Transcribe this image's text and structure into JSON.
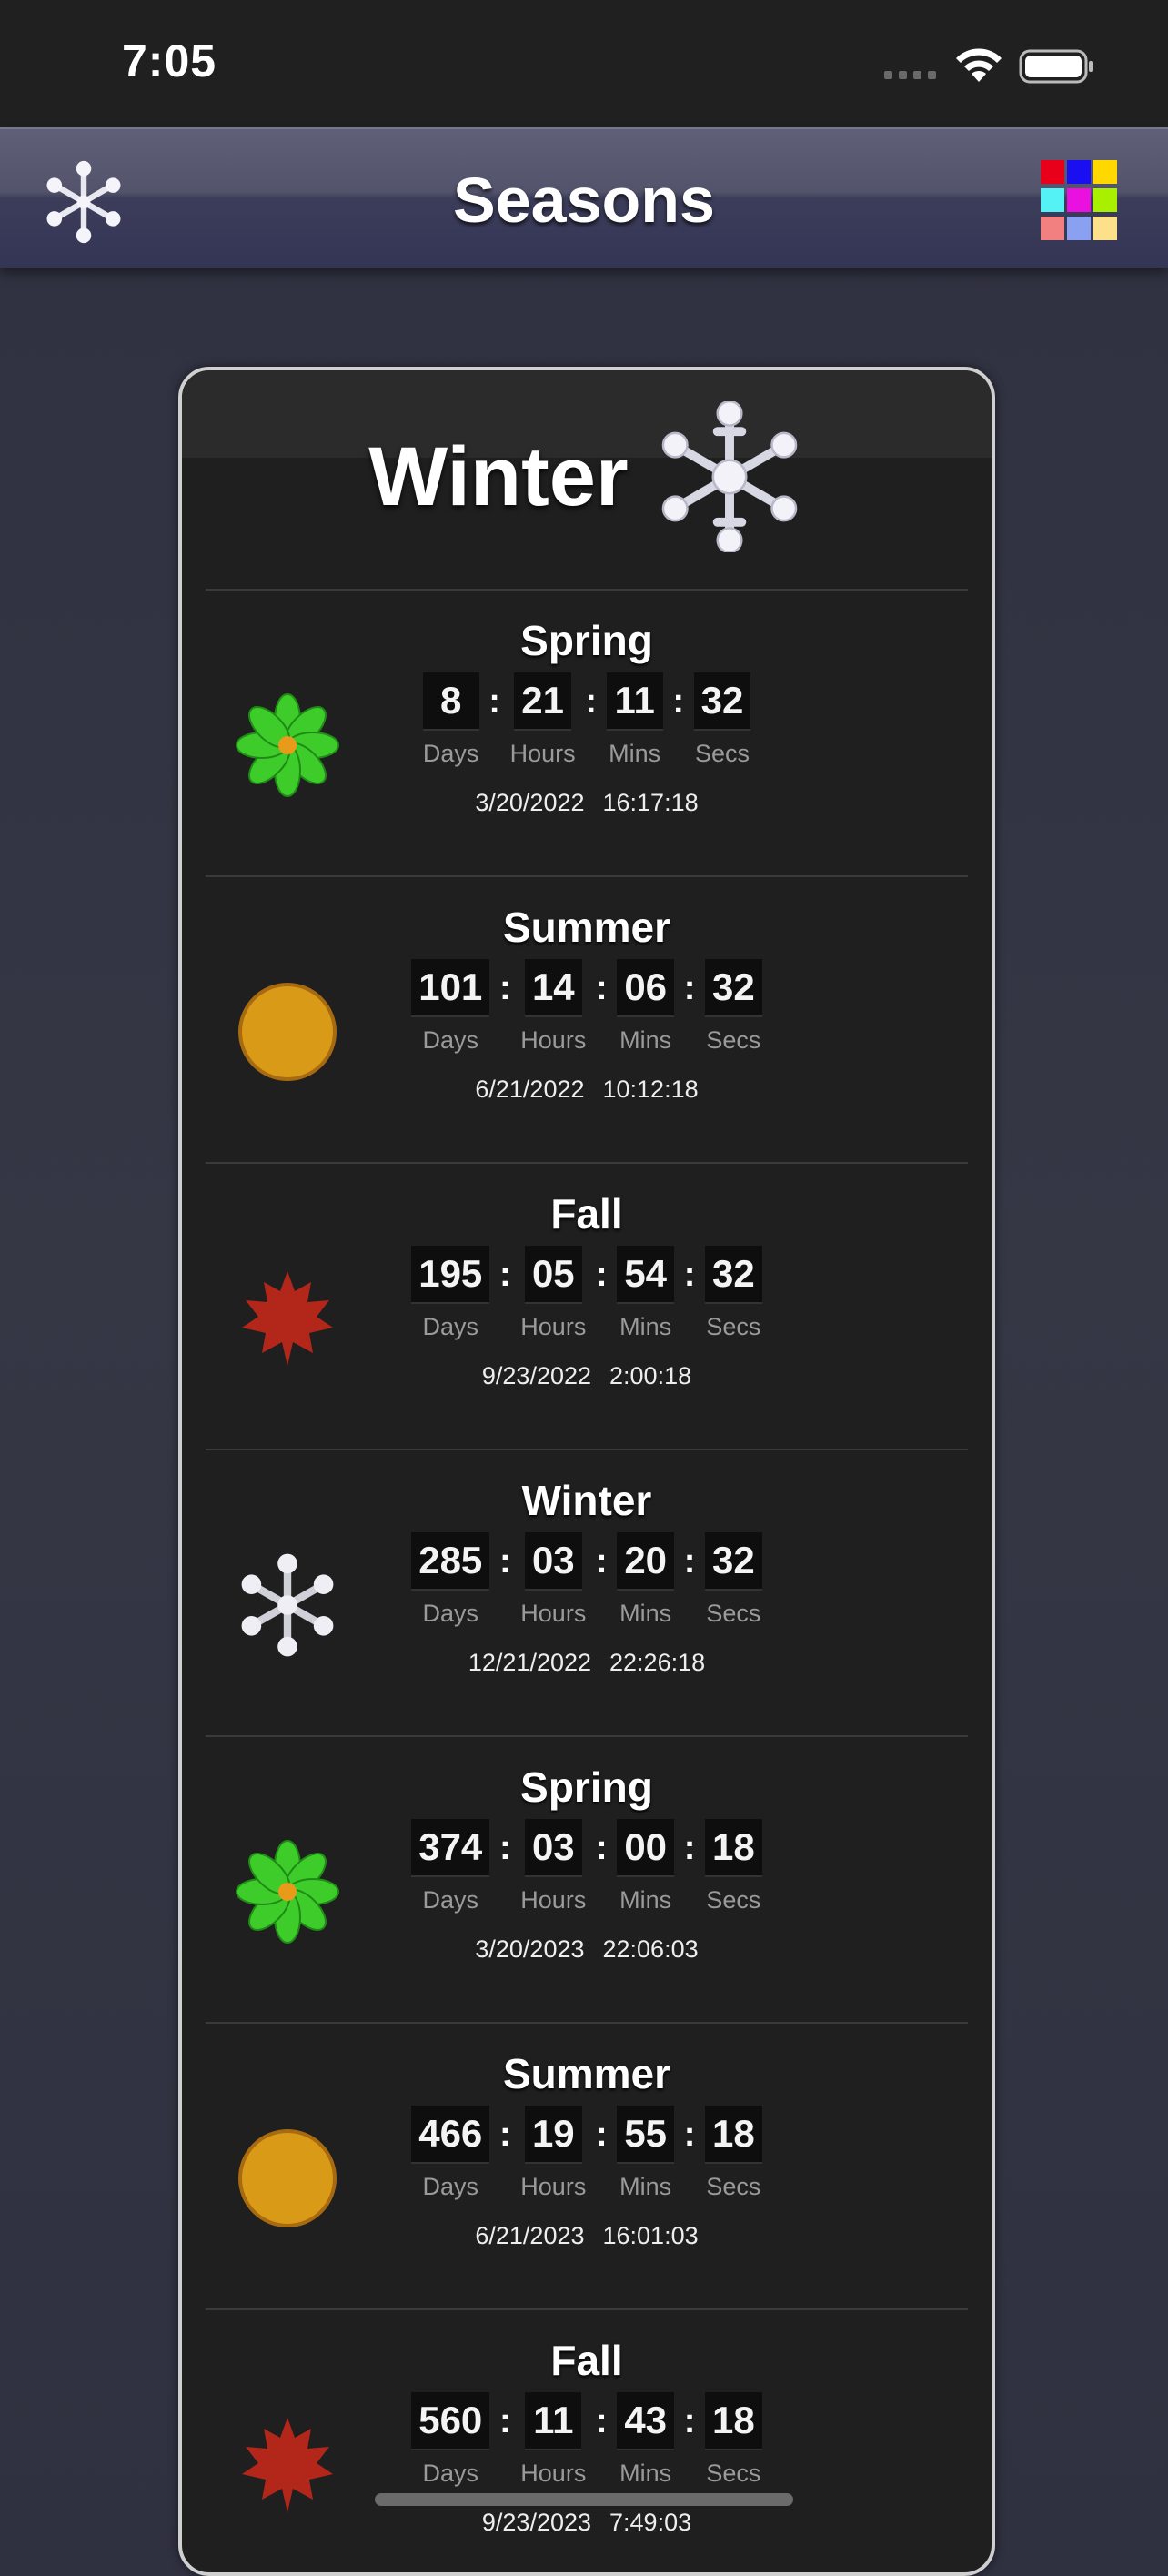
{
  "status": {
    "time": "7:05"
  },
  "nav": {
    "title": "Seasons",
    "left_icon": "snowflake-icon",
    "right_icon": "color-grid-icon"
  },
  "current_season": {
    "label": "Winter",
    "icon": "snowflake-icon"
  },
  "rows": [
    {
      "name": "Spring",
      "icon": "flower",
      "days": "8",
      "hours": "21",
      "mins": "11",
      "secs": "32",
      "date": "3/20/2022",
      "time": "16:17:18"
    },
    {
      "name": "Summer",
      "icon": "sun",
      "days": "101",
      "hours": "14",
      "mins": "06",
      "secs": "32",
      "date": "6/21/2022",
      "time": "10:12:18"
    },
    {
      "name": "Fall",
      "icon": "leaf",
      "days": "195",
      "hours": "05",
      "mins": "54",
      "secs": "32",
      "date": "9/23/2022",
      "time": "2:00:18"
    },
    {
      "name": "Winter",
      "icon": "snowflake",
      "days": "285",
      "hours": "03",
      "mins": "20",
      "secs": "32",
      "date": "12/21/2022",
      "time": "22:26:18"
    },
    {
      "name": "Spring",
      "icon": "flower",
      "days": "374",
      "hours": "03",
      "mins": "00",
      "secs": "18",
      "date": "3/20/2023",
      "time": "22:06:03"
    },
    {
      "name": "Summer",
      "icon": "sun",
      "days": "466",
      "hours": "19",
      "mins": "55",
      "secs": "18",
      "date": "6/21/2023",
      "time": "16:01:03"
    },
    {
      "name": "Fall",
      "icon": "leaf",
      "days": "560",
      "hours": "11",
      "mins": "43",
      "secs": "18",
      "date": "9/23/2023",
      "time": "7:49:03"
    }
  ],
  "units": {
    "days": "Days",
    "hours": "Hours",
    "mins": "Mins",
    "secs": "Secs"
  },
  "colors": {
    "grid": [
      "#e8001b",
      "#1a0ff0",
      "#ffd800",
      "#55f2f5",
      "#ea10e0",
      "#a8f000",
      "#f28080",
      "#8aa0f0",
      "#fde08a"
    ],
    "sun": "#d99a18",
    "flower": "#3dcc2a",
    "leaf": "#b3261a"
  }
}
